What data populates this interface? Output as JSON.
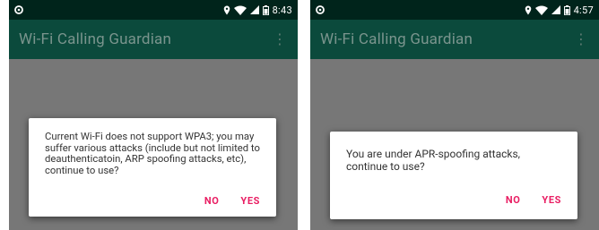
{
  "screens": [
    {
      "status": {
        "time": "8:43"
      },
      "appbar": {
        "title": "Wi-Fi Calling Guardian"
      },
      "dialog": {
        "message": "Current Wi-Fi does not support WPA3; you may suffer various attacks (include but not limited to deauthenticatoin, ARP spoofing attacks, etc), continue to use?",
        "no": "NO",
        "yes": "YES"
      }
    },
    {
      "status": {
        "time": "4:57"
      },
      "appbar": {
        "title": "Wi-Fi Calling Guardian"
      },
      "dialog": {
        "message": "You are under APR-spoofing attacks, continue to use?",
        "no": "NO",
        "yes": "YES"
      }
    }
  ],
  "colors": {
    "status_bar": "#00241b",
    "app_bar": "#0b4a3c",
    "title_text": "#7a948d",
    "scrim": "#777777",
    "accent": "#e91e63"
  },
  "icons": [
    "notification-icon",
    "location-icon",
    "wifi-icon",
    "signal-icon",
    "battery-icon",
    "overflow-menu-icon"
  ]
}
